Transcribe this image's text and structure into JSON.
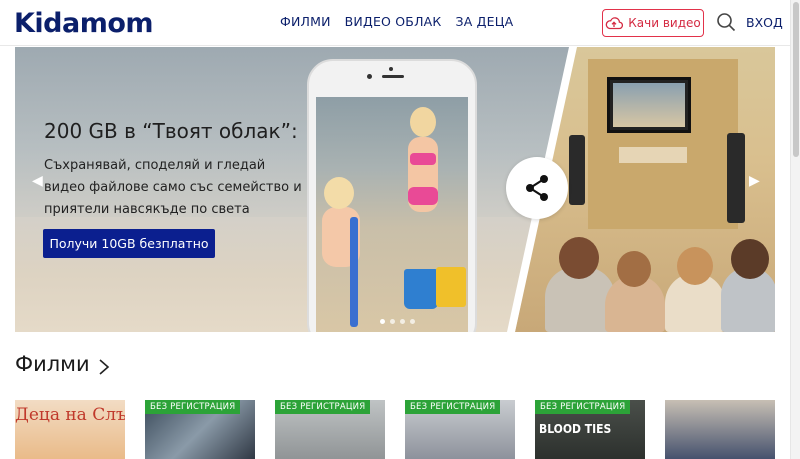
{
  "header": {
    "logo_text": "Kidamom",
    "nav": [
      {
        "label": "ФИЛМИ"
      },
      {
        "label": "ВИДЕО ОБЛАК"
      },
      {
        "label": "ЗА ДЕЦА"
      }
    ],
    "upload_label": "Качи видео",
    "login_label": "ВХОД",
    "icons": {
      "upload": "cloud-upload-icon",
      "search": "search-icon"
    }
  },
  "hero": {
    "title": "200 GB в “Твоят облак”:",
    "text": "Съхранявай, споделяй и гледай видео файлове само със семейство и приятели навсякъде по света",
    "cta_label": "Получи 10GB безплатно",
    "slide_indicator": {
      "count": 4,
      "active": 0
    }
  },
  "films": {
    "title": "Филми",
    "tiles": [
      {
        "badge": "",
        "title": "Деца на Слънцето"
      },
      {
        "badge": "БЕЗ РЕГИСТРАЦИЯ",
        "title": ""
      },
      {
        "badge": "БЕЗ РЕГИСТРАЦИЯ",
        "title": ""
      },
      {
        "badge": "БЕЗ РЕГИСТРАЦИЯ",
        "title": ""
      },
      {
        "badge": "БЕЗ РЕГИСТРАЦИЯ",
        "title": "BLOOD TIES"
      },
      {
        "badge": "",
        "title": ""
      }
    ]
  },
  "colors": {
    "brand": "#0b1f6b",
    "cta": "#0b1f8f",
    "upload_border": "#e2324a",
    "badge": "#2ca338"
  }
}
